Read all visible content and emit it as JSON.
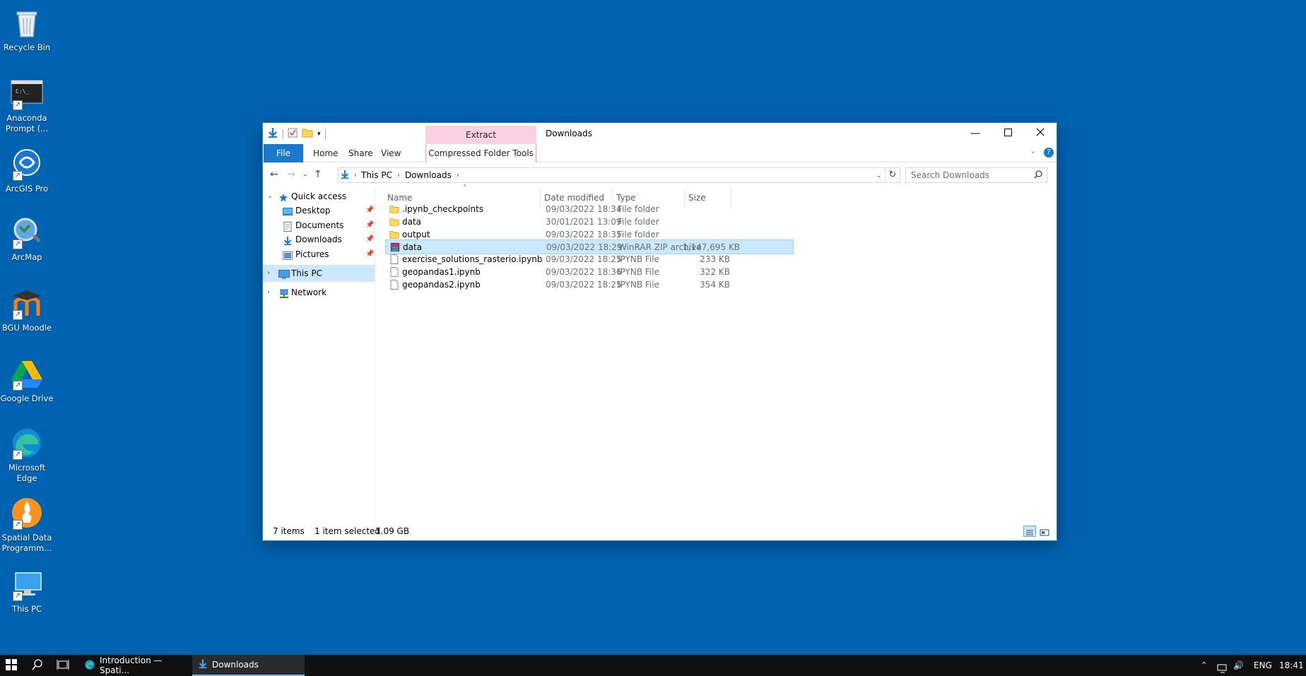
{
  "desktop": {
    "icons": [
      {
        "label": "Recycle Bin"
      },
      {
        "label": "Anaconda Prompt (..."
      },
      {
        "label": "ArcGIS Pro"
      },
      {
        "label": "ArcMap"
      },
      {
        "label": "BGU Moodle"
      },
      {
        "label": "Google Drive"
      },
      {
        "label": "Microsoft Edge"
      },
      {
        "label": "Spatial Data Programm..."
      },
      {
        "label": "This PC"
      }
    ]
  },
  "window": {
    "title": "Downloads",
    "context_tab_group": "Extract",
    "ribbon_tabs": [
      "File",
      "Home",
      "Share",
      "View",
      "Compressed Folder Tools"
    ],
    "path": [
      "This PC",
      "Downloads"
    ],
    "search_placeholder": "Search Downloads",
    "nav": {
      "quick_access": "Quick access",
      "quick_items": [
        "Desktop",
        "Documents",
        "Downloads",
        "Pictures"
      ],
      "this_pc": "This PC",
      "network": "Network"
    },
    "columns": [
      "Name",
      "Date modified",
      "Type",
      "Size"
    ],
    "files": [
      {
        "name": ".ipynb_checkpoints",
        "date": "09/03/2022 18:34",
        "type": "File folder",
        "size": "",
        "kind": "folder"
      },
      {
        "name": "data",
        "date": "30/01/2021 13:09",
        "type": "File folder",
        "size": "",
        "kind": "folder"
      },
      {
        "name": "output",
        "date": "09/03/2022 18:35",
        "type": "File folder",
        "size": "",
        "kind": "folder"
      },
      {
        "name": "data",
        "date": "09/03/2022 18:29",
        "type": "WinRAR ZIP archive",
        "size": "1,147,695 KB",
        "kind": "zip",
        "selected": true
      },
      {
        "name": "exercise_solutions_rasterio.ipynb",
        "date": "09/03/2022 18:25",
        "type": "IPYNB File",
        "size": "233 KB",
        "kind": "file"
      },
      {
        "name": "geopandas1.ipynb",
        "date": "09/03/2022 18:36",
        "type": "IPYNB File",
        "size": "322 KB",
        "kind": "file"
      },
      {
        "name": "geopandas2.ipynb",
        "date": "09/03/2022 18:25",
        "type": "IPYNB File",
        "size": "354 KB",
        "kind": "file"
      }
    ],
    "status": {
      "items": "7 items",
      "selected": "1 item selected",
      "selected_size": "1.09 GB"
    }
  },
  "taskbar": {
    "apps": [
      {
        "label": "Introduction — Spati..."
      },
      {
        "label": "Downloads"
      }
    ],
    "lang": "ENG",
    "time": "18:41"
  },
  "colors": {
    "desktop": "#0063b1",
    "selection": "#cce8ff",
    "context_tab": "#fbd0e0",
    "file_tab": "#1979ca"
  }
}
